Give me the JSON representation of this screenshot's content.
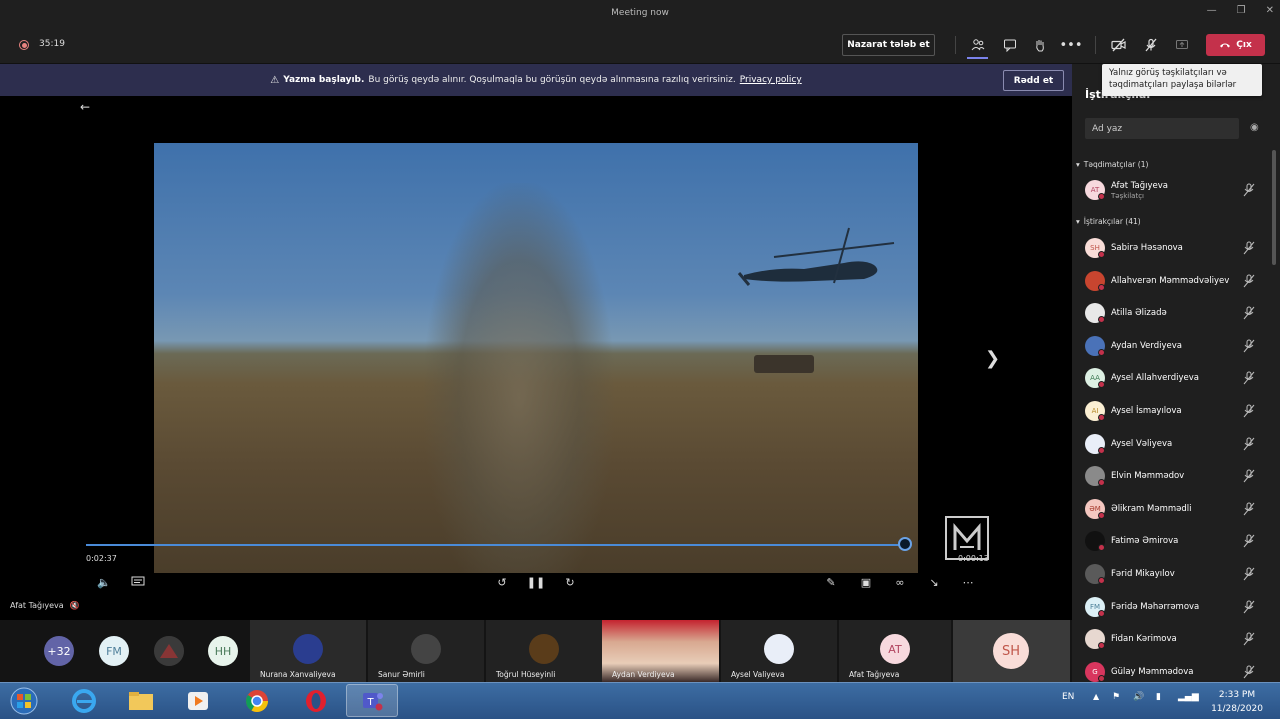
{
  "window": {
    "title": "Meeting now"
  },
  "toolbar": {
    "timer": "35:19",
    "request_control_label": "Nazarat tələb et",
    "leave_label": "Çıx"
  },
  "tooltip": {
    "text": "Yalnız görüş təşkilatçıları və təqdimatçıları paylaşa bilərlər"
  },
  "banner": {
    "bold": "Yazma başlayıb.",
    "text": "Bu görüş qeydə alınır. Qoşulmaqla bu görüşün qeydə alınmasına razılıq verirsiniz.",
    "link": "Privacy policy",
    "dismiss_label": "Rədd et"
  },
  "player": {
    "elapsed": "0:02:37",
    "remaining": "0:00:13",
    "progress": 0.995,
    "presenter": "Afat Tağıyeva"
  },
  "gallery": {
    "overflow": "+32",
    "avatars": [
      {
        "initials": "FM",
        "color": "#e3f1f5",
        "text": "#4f7f9a"
      },
      {
        "initials": "",
        "color": "#2d2d2d",
        "text": "#fff"
      },
      {
        "initials": "HH",
        "color": "#e8f4ec",
        "text": "#4a7a5a"
      }
    ],
    "tiles": [
      {
        "name": "Nurana Xanvaliyeva"
      },
      {
        "name": "Sanur Əmirli"
      },
      {
        "name": "Toğrul Hüseyinli"
      },
      {
        "name": "Aydan Verdiyeva"
      },
      {
        "name": "Aysel Valiyeva"
      },
      {
        "name": "Afat Tağıyeva",
        "initials": "AT"
      },
      {
        "name": "",
        "initials": "SH"
      }
    ]
  },
  "sidebar": {
    "title": "İştirakçılar",
    "search_placeholder": "Ad yaz",
    "presenters_header": "Təqdimatçılar (1)",
    "attendees_header": "İştirakçılar (41)",
    "presenters": [
      {
        "name": "Afət Tağıyeva",
        "role": "Təşkilatçı",
        "initials": "AT",
        "color": "#f7d9de",
        "text": "#b24560"
      }
    ],
    "attendees": [
      {
        "name": "Sabirə Həsənova",
        "initials": "SH",
        "color": "#f9ddd8",
        "text": "#c0564a"
      },
      {
        "name": "Allahverən Məmmədvəliyev",
        "initials": "",
        "color": "#c8452f",
        "text": "#fff"
      },
      {
        "name": "Atilla Əlizadə",
        "initials": "",
        "color": "#e8e8e8",
        "text": "#222"
      },
      {
        "name": "Aydan Verdiyeva",
        "initials": "",
        "color": "#4a72b8",
        "text": "#fff"
      },
      {
        "name": "Aysel Allahverdiyeva",
        "initials": "AA",
        "color": "#ddf0e3",
        "text": "#3d7a53"
      },
      {
        "name": "Aysel İsmayılova",
        "initials": "AI",
        "color": "#fbefd3",
        "text": "#b58a2b"
      },
      {
        "name": "Aysel Vəliyeva",
        "initials": "",
        "color": "#e9eef8",
        "text": "#333"
      },
      {
        "name": "Elvin Məmmədov",
        "initials": "",
        "color": "#8a8a8a",
        "text": "#fff"
      },
      {
        "name": "Əlikram Məmmədli",
        "initials": "ƏM",
        "color": "#f4c7c0",
        "text": "#a83d30"
      },
      {
        "name": "Fatimə Əmirova",
        "initials": "",
        "color": "#111111",
        "text": "#fff"
      },
      {
        "name": "Fərid Mikayılov",
        "initials": "",
        "color": "#5a5a5a",
        "text": "#fff"
      },
      {
        "name": "Fəridə Məhərrəmova",
        "initials": "FM",
        "color": "#dcf0f6",
        "text": "#4a7f98"
      },
      {
        "name": "Fidan Kərimova",
        "initials": "",
        "color": "#e7d8d0",
        "text": "#333"
      },
      {
        "name": "Gülay Məmmədova",
        "initials": "G",
        "color": "#d8365e",
        "text": "#fff"
      }
    ]
  },
  "taskbar": {
    "lang": "EN",
    "time": "2:33 PM",
    "date": "11/28/2020"
  }
}
